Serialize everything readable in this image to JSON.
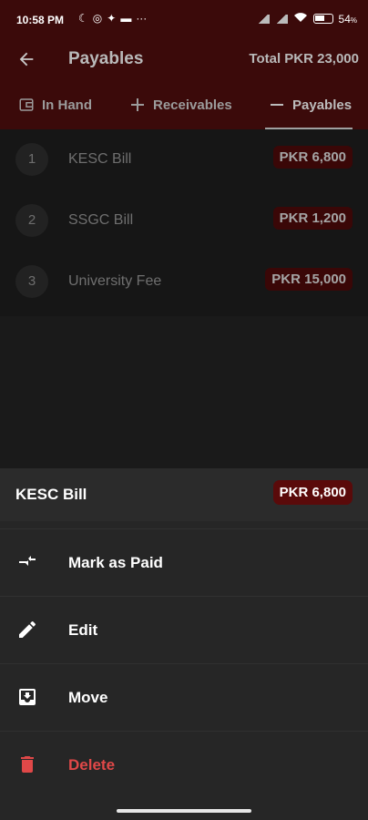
{
  "status_bar": {
    "time": "10:58 PM",
    "battery": "54"
  },
  "app_bar": {
    "title": "Payables",
    "total": "Total PKR 23,000"
  },
  "tabs": [
    {
      "label": "In Hand",
      "icon": "wallet-icon",
      "active": false
    },
    {
      "label": "Receivables",
      "icon": "plus-icon",
      "active": false
    },
    {
      "label": "Payables",
      "icon": "minus-icon",
      "active": true
    }
  ],
  "items": [
    {
      "num": "1",
      "name": "KESC Bill",
      "amount": "PKR 6,800"
    },
    {
      "num": "2",
      "name": "SSGC Bill",
      "amount": "PKR 1,200"
    },
    {
      "num": "3",
      "name": "University Fee",
      "amount": "PKR 15,000"
    }
  ],
  "sheet": {
    "title": "KESC Bill",
    "amount": "PKR 6,800",
    "actions": [
      {
        "label": "Mark as Paid",
        "icon": "swap-arrows-icon"
      },
      {
        "label": "Edit",
        "icon": "pencil-icon"
      },
      {
        "label": "Move",
        "icon": "move-to-inbox-icon"
      },
      {
        "label": "Delete",
        "icon": "trash-icon"
      }
    ]
  },
  "colors": {
    "app_bar": "#3b0a0a",
    "amount_chip": "#5a0a0a",
    "danger": "#e04848",
    "sheet_bg": "#262626"
  }
}
